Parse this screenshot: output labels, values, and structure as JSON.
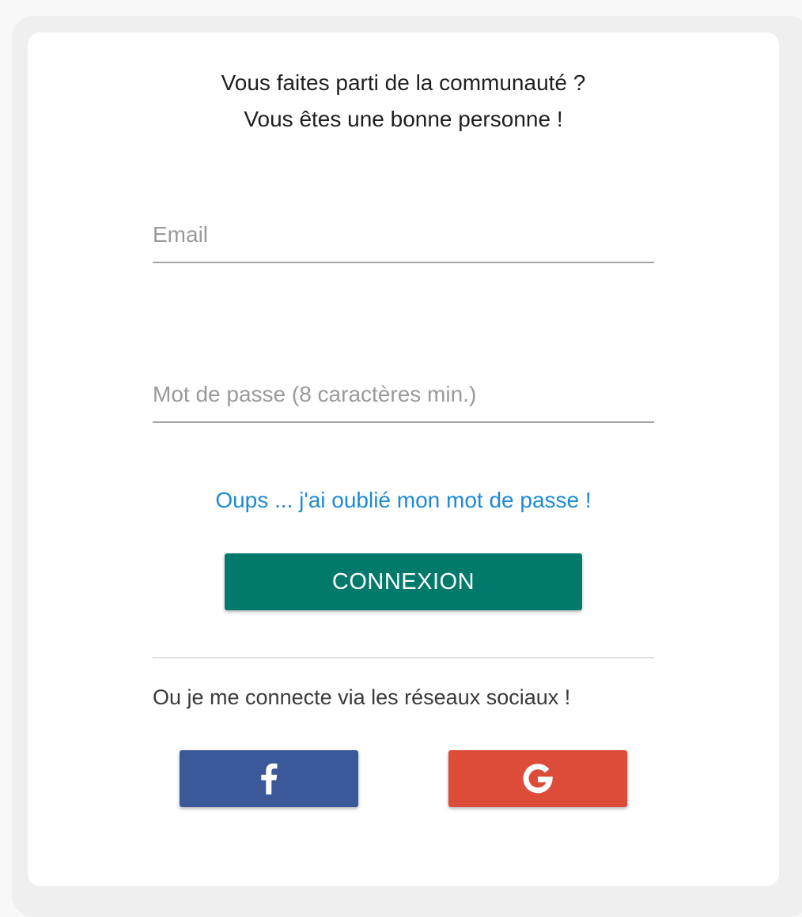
{
  "header": {
    "line1": "Vous faites parti de la communauté ?",
    "line2": "Vous êtes une bonne personne !"
  },
  "form": {
    "email": {
      "value": "",
      "placeholder": "Email"
    },
    "password": {
      "value": "",
      "placeholder": "Mot de passe (8 caractères min.)"
    },
    "forgot_link": "Oups ... j'ai oublié mon mot de passe !",
    "submit_label": "CONNEXION"
  },
  "social": {
    "text": "Ou je me connecte via les réseaux sociaux !",
    "buttons": [
      {
        "icon": "facebook-icon",
        "color": "#3b5999"
      },
      {
        "icon": "google-icon",
        "color": "#dd4b39"
      }
    ]
  },
  "colors": {
    "primary": "#01796b",
    "link": "#1e8ad6",
    "facebook": "#3b5999",
    "google": "#dd4b39"
  }
}
